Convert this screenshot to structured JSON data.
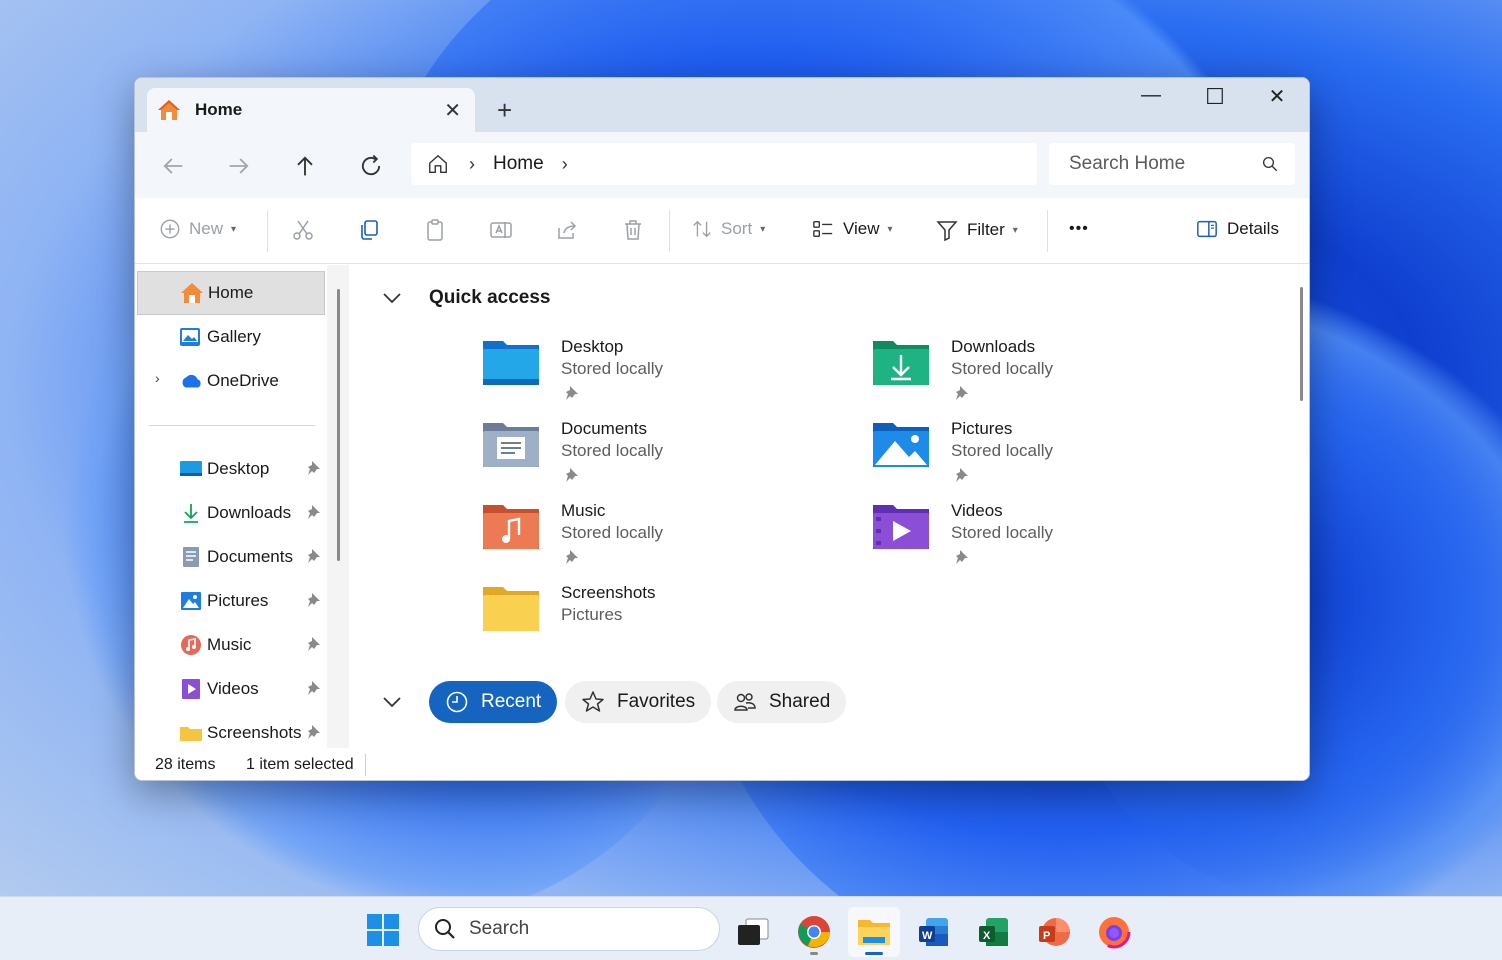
{
  "window": {
    "tab_title": "Home",
    "tab_close": "✕",
    "new_tab": "+",
    "controls": {
      "minimize": "—",
      "maximize": "☐",
      "close": "✕"
    }
  },
  "address": {
    "crumbs": [
      "Home"
    ],
    "search_placeholder": "Search Home"
  },
  "commands": {
    "new": "New",
    "sort": "Sort",
    "view": "View",
    "filter": "Filter",
    "more": "•••",
    "details": "Details"
  },
  "sidebar": {
    "items": [
      {
        "label": "Home",
        "icon": "home-icon",
        "selected": true
      },
      {
        "label": "Gallery",
        "icon": "gallery-icon"
      },
      {
        "label": "OneDrive",
        "icon": "onedrive-icon",
        "expandable": true
      },
      {
        "label": "Desktop",
        "icon": "desktop-icon",
        "pinned": true
      },
      {
        "label": "Downloads",
        "icon": "downloads-icon",
        "pinned": true
      },
      {
        "label": "Documents",
        "icon": "documents-icon",
        "pinned": true
      },
      {
        "label": "Pictures",
        "icon": "pictures-icon",
        "pinned": true
      },
      {
        "label": "Music",
        "icon": "music-icon",
        "pinned": true
      },
      {
        "label": "Videos",
        "icon": "videos-icon",
        "pinned": true
      },
      {
        "label": "Screenshots",
        "icon": "screenshots-icon",
        "pinned": true
      }
    ]
  },
  "quick_access": {
    "title": "Quick access",
    "folders": [
      {
        "name": "Desktop",
        "sub": "Stored locally",
        "pinned": true,
        "icon": "desktop-folder-icon"
      },
      {
        "name": "Downloads",
        "sub": "Stored locally",
        "pinned": true,
        "icon": "downloads-folder-icon"
      },
      {
        "name": "Documents",
        "sub": "Stored locally",
        "pinned": true,
        "icon": "documents-folder-icon"
      },
      {
        "name": "Pictures",
        "sub": "Stored locally",
        "pinned": true,
        "icon": "pictures-folder-icon"
      },
      {
        "name": "Music",
        "sub": "Stored locally",
        "pinned": true,
        "icon": "music-folder-icon"
      },
      {
        "name": "Videos",
        "sub": "Stored locally",
        "pinned": true,
        "icon": "videos-folder-icon"
      },
      {
        "name": "Screenshots",
        "sub": "Pictures",
        "pinned": false,
        "icon": "screenshots-folder-icon"
      }
    ]
  },
  "filters": {
    "recent": "Recent",
    "favorites": "Favorites",
    "shared": "Shared"
  },
  "status": {
    "items": "28 items",
    "selected": "1 item selected"
  },
  "taskbar": {
    "search_label": "Search",
    "apps": [
      "task-view",
      "chrome",
      "file-explorer",
      "word",
      "excel",
      "powerpoint",
      "firefox"
    ]
  },
  "colors": {
    "accent": "#1565c0",
    "titlebar": "#d8e2ef",
    "toolbar": "#f3f6fa"
  }
}
